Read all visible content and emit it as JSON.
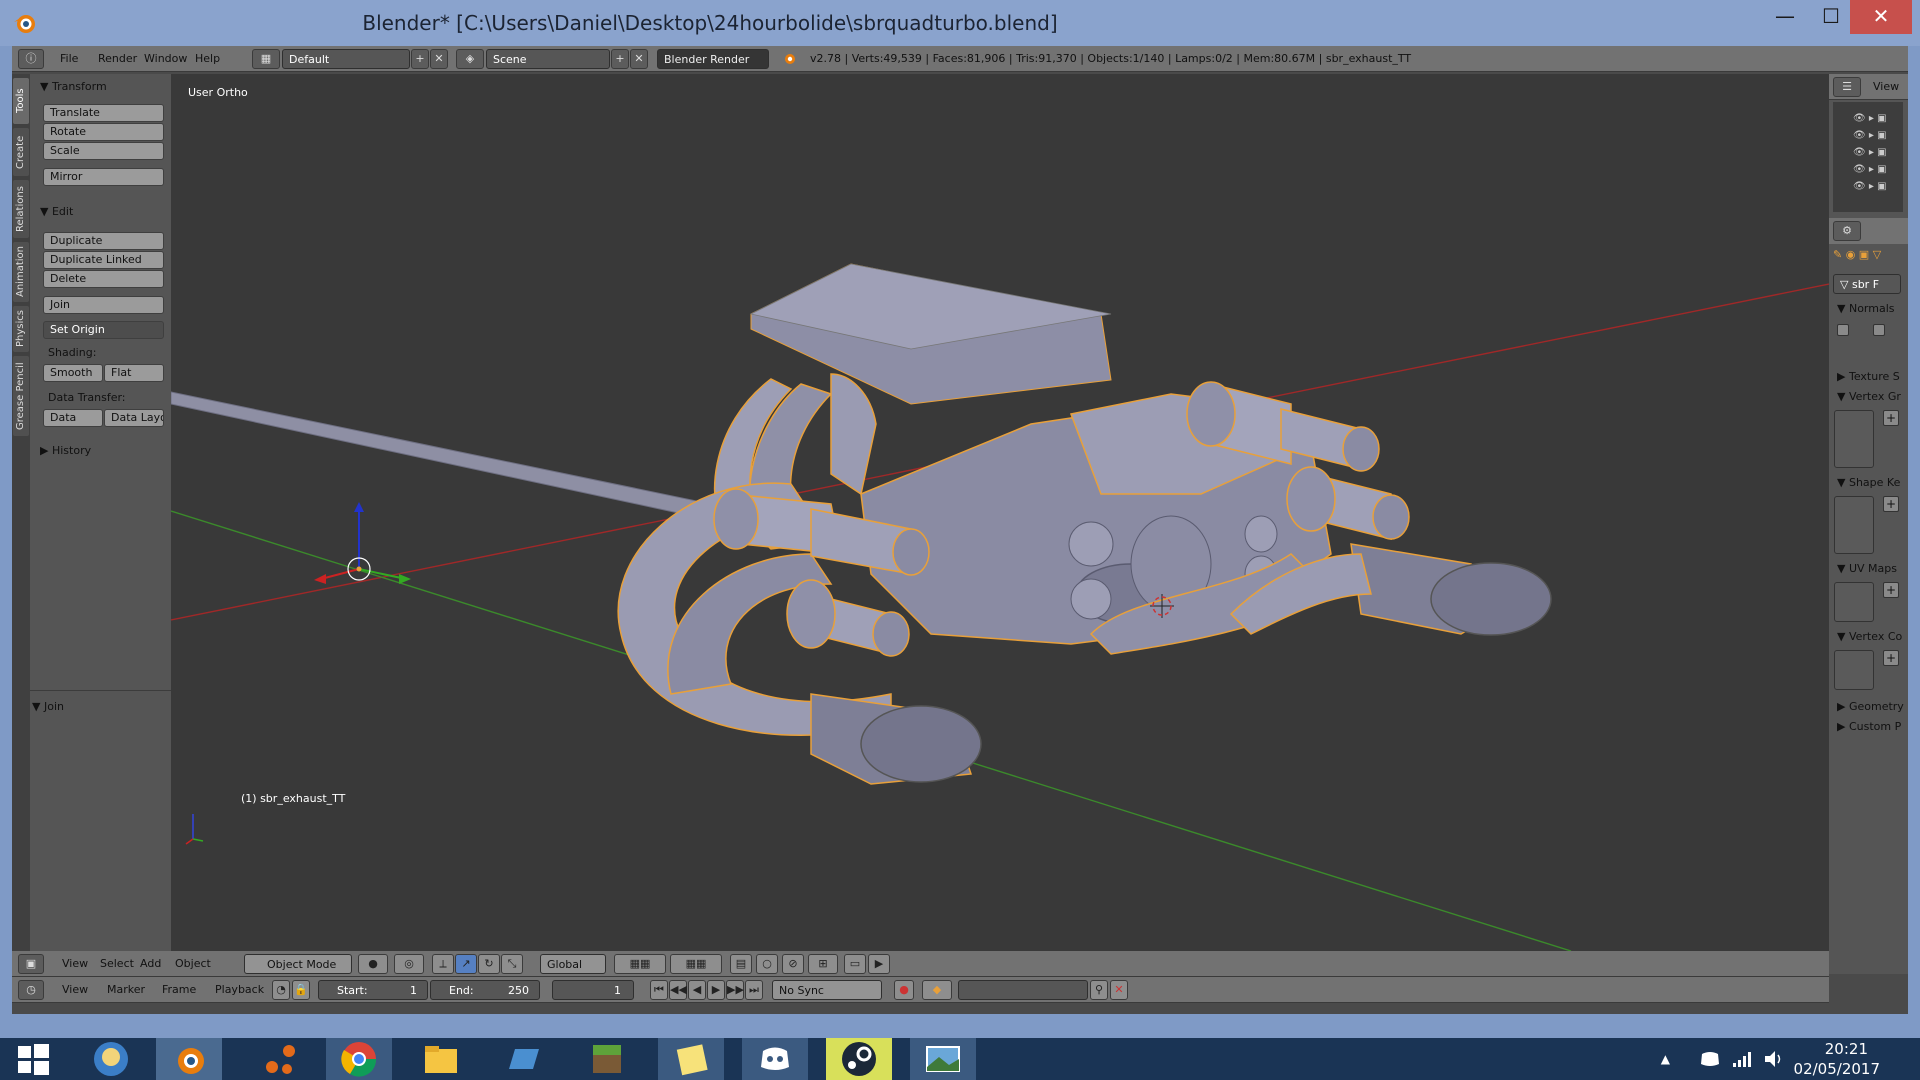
{
  "window": {
    "title": "Blender* [C:\\Users\\Daniel\\Desktop\\24hourbolide\\sbrquadturbo.blend]",
    "minimize": "—",
    "maximize": "☐",
    "close": "✕"
  },
  "top_header": {
    "menus": [
      "File",
      "Render",
      "Window",
      "Help"
    ],
    "layout_name": "Default",
    "scene_name": "Scene",
    "render_engine": "Blender Render",
    "stats": "v2.78 | Verts:49,539 | Faces:81,906 | Tris:91,370 | Objects:1/140 | Lamps:0/2 | Mem:80.67M | sbr_exhaust_TT"
  },
  "tool_tabs": [
    "Tools",
    "Create",
    "Relations",
    "Animation",
    "Physics",
    "Grease Pencil"
  ],
  "tool_panel": {
    "transform_title": "Transform",
    "transform_buttons": [
      "Translate",
      "Rotate",
      "Scale"
    ],
    "mirror": "Mirror",
    "edit_title": "Edit",
    "edit_buttons": [
      "Duplicate",
      "Duplicate Linked",
      "Delete"
    ],
    "join": "Join",
    "set_origin": "Set Origin",
    "shading_label": "Shading:",
    "smooth": "Smooth",
    "flat": "Flat",
    "data_transfer_label": "Data Transfer:",
    "data": "Data",
    "data_layout": "Data Layo",
    "history_title": "History",
    "operator_title": "Join"
  },
  "viewport": {
    "view_name": "User Ortho",
    "object_name": "(1) sbr_exhaust_TT"
  },
  "view3d_header": {
    "menus": [
      "View",
      "Select",
      "Add",
      "Object"
    ],
    "mode": "Object Mode",
    "orientation": "Global"
  },
  "timeline_header": {
    "menus": [
      "View",
      "Marker",
      "Frame",
      "Playback"
    ],
    "start_label": "Start:",
    "start_value": "1",
    "end_label": "End:",
    "end_value": "250",
    "current_frame": "1",
    "sync": "No Sync"
  },
  "properties": {
    "view_label": "View",
    "object_name": "sbr",
    "f_label": "F",
    "sections": [
      "Normals",
      "Texture S",
      "Vertex Gr",
      "Shape Ke",
      "UV Maps",
      "Vertex Co",
      "Geometry",
      "Custom P"
    ]
  },
  "taskbar": {
    "apps": [
      "start-icon",
      "fallout-shelter-icon",
      "blender-icon",
      "substance-icon",
      "chrome-icon",
      "file-explorer-icon",
      "app-icon",
      "minecraft-icon",
      "notes-icon",
      "discord-icon",
      "steam-icon",
      "photos-icon"
    ],
    "time": "20:21",
    "date": "02/05/2017"
  },
  "colors": {
    "selection_outline": "#e8a03a",
    "mesh_fill": "#9a9bb2",
    "viewport_bg": "#393939",
    "x_axis": "#a02828",
    "y_axis": "#3b8a2b"
  }
}
